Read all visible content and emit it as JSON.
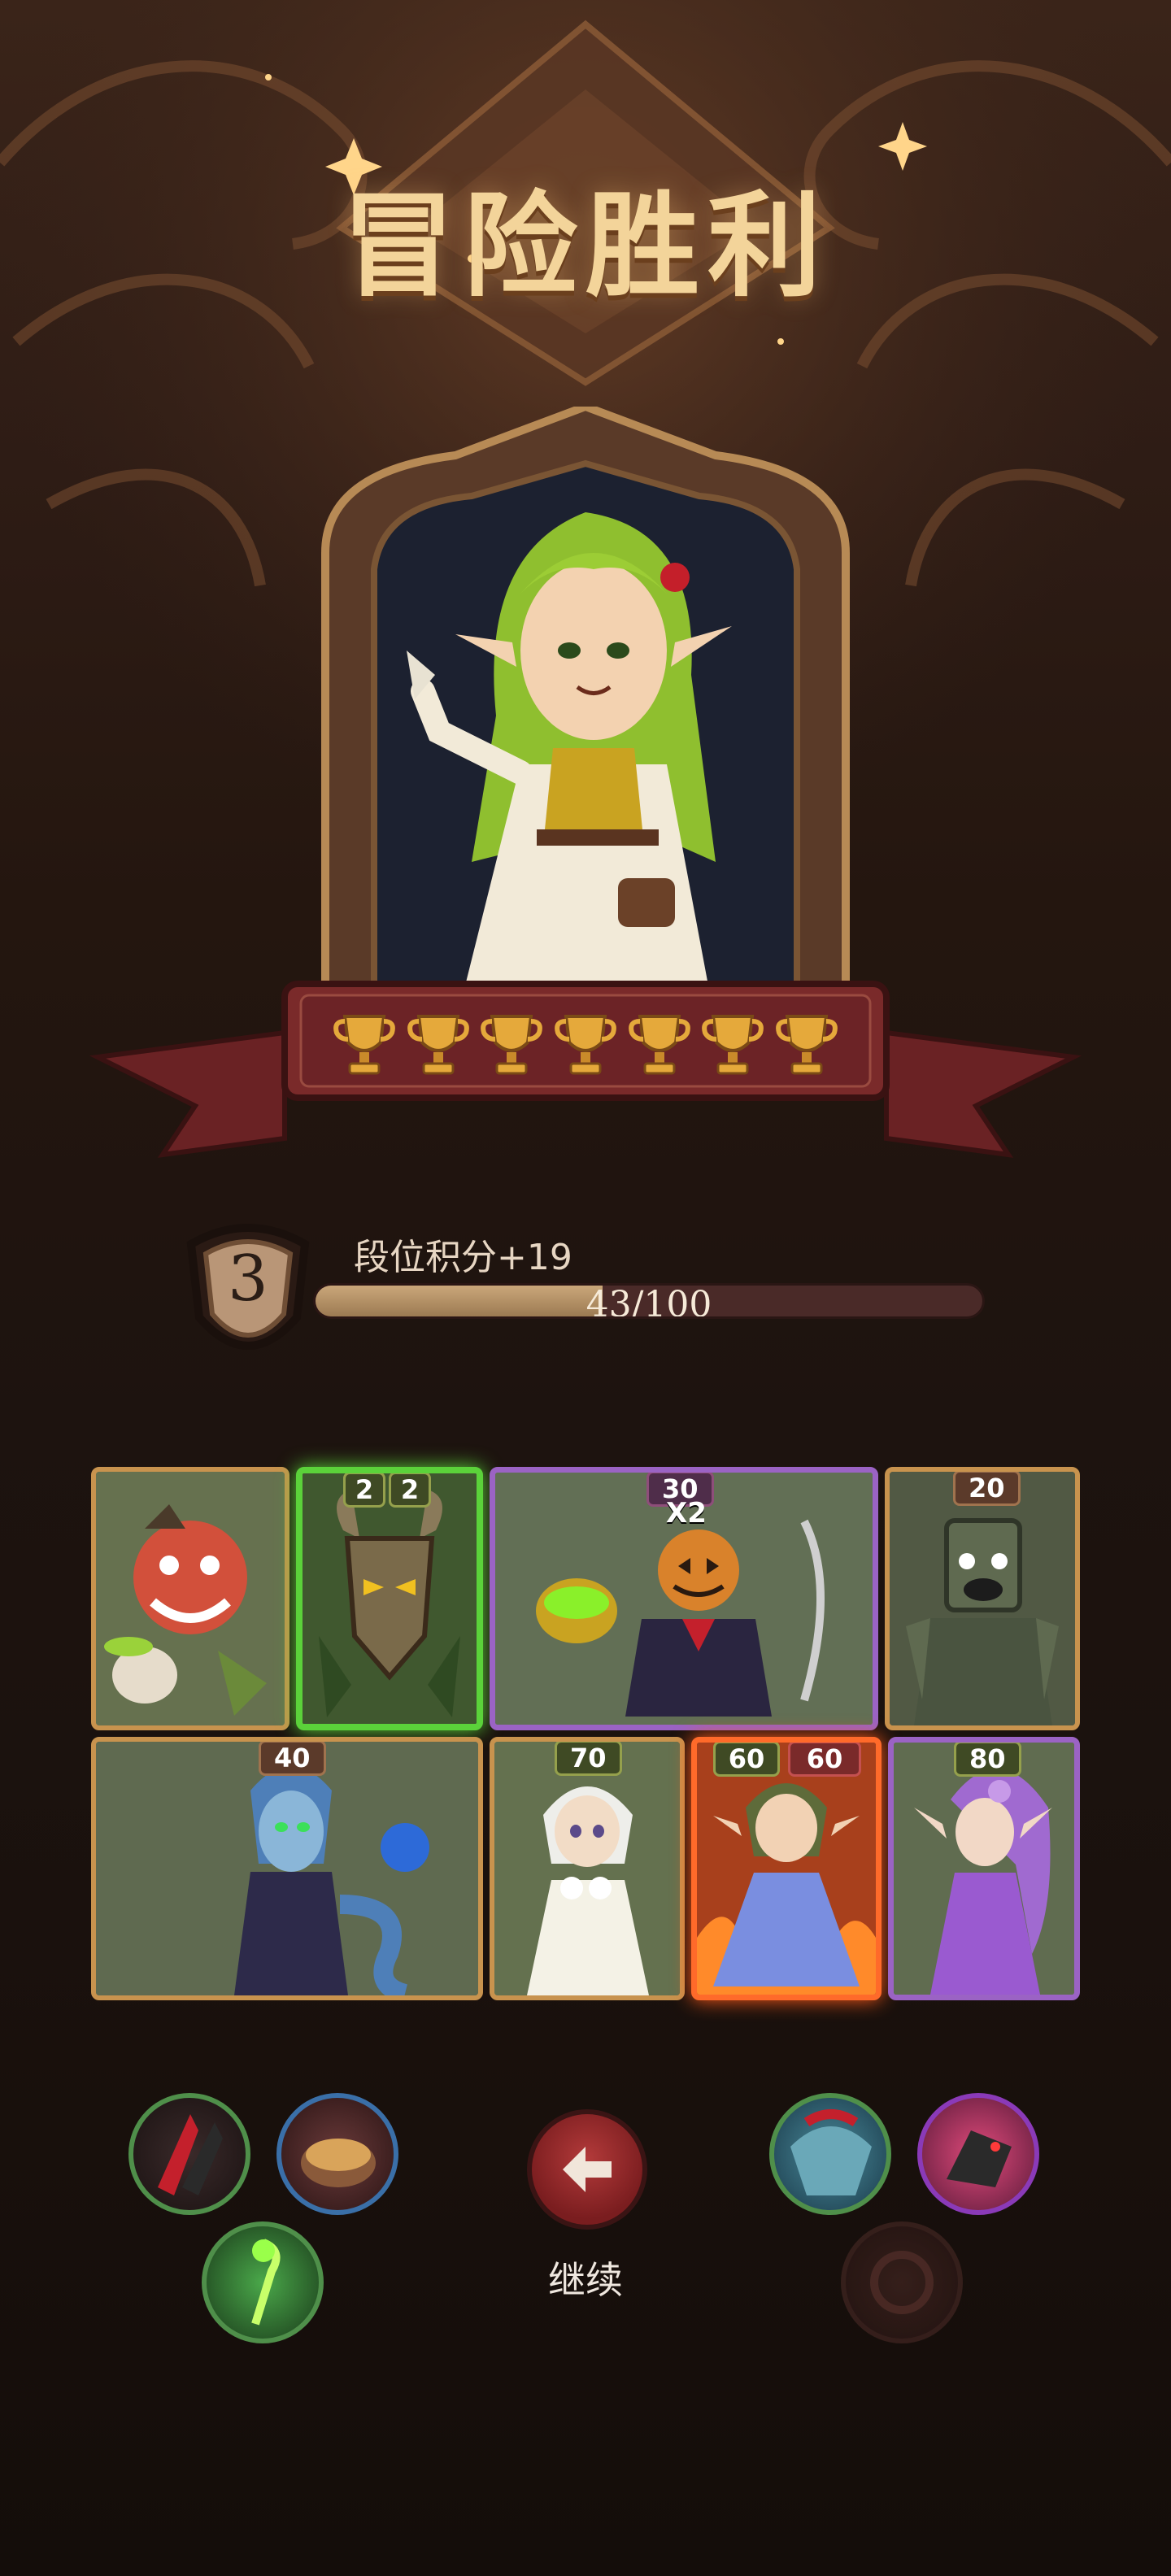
{
  "title": "冒险胜利",
  "hero": {
    "trophy_count": 7,
    "trophy_icon": "trophy-icon"
  },
  "rank": {
    "tier": "3",
    "label": "段位积分+19",
    "progress_text": "43/100",
    "progress_value": 43,
    "progress_max": 100
  },
  "cards": {
    "row1": [
      {
        "name": "tomato-demon-card",
        "cost": null,
        "frame": "gold"
      },
      {
        "name": "wooden-mask-card",
        "cost": [
          "2",
          "2"
        ],
        "frame": "green"
      },
      {
        "name": "pumpkin-reaper-card",
        "cost": "30",
        "multiplier": "X2",
        "frame": "purple"
      },
      {
        "name": "stone-golem-card",
        "cost": "20",
        "frame": "gold"
      }
    ],
    "row2": [
      {
        "name": "sea-witch-card",
        "cost": "40",
        "frame": "gold"
      },
      {
        "name": "flower-fairy-card",
        "cost": "70",
        "frame": "gold"
      },
      {
        "name": "blue-dress-elf-card",
        "cost": [
          "60",
          "60"
        ],
        "frame": "fire"
      },
      {
        "name": "purple-elf-card",
        "cost": "80",
        "frame": "purple"
      }
    ]
  },
  "continue_label": "继续",
  "colors": {
    "title": "#f3d49a",
    "banner": "#7a2a2a",
    "green_frame": "#5bd23a",
    "purple_frame": "#9b63c4",
    "gold_frame": "#c8934e"
  }
}
